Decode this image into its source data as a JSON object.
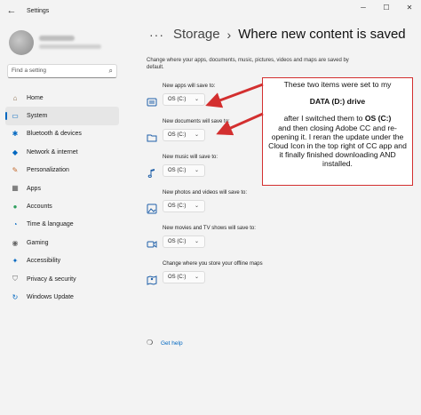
{
  "window": {
    "title": "Settings",
    "back_glyph": "←",
    "min_glyph": "─",
    "max_glyph": "☐",
    "close_glyph": "✕"
  },
  "sidebar": {
    "search_placeholder": "Find a setting",
    "search_icon_glyph": "⌕",
    "items": [
      {
        "label": "Home",
        "icon": "home-icon",
        "glyph": "⌂",
        "color": "#8a6a4a"
      },
      {
        "label": "System",
        "icon": "system-icon",
        "glyph": "▭",
        "color": "#0067c0",
        "active": true
      },
      {
        "label": "Bluetooth & devices",
        "icon": "bluetooth-icon",
        "glyph": "✱",
        "color": "#0067c0"
      },
      {
        "label": "Network & internet",
        "icon": "network-icon",
        "glyph": "◆",
        "color": "#0067c0"
      },
      {
        "label": "Personalization",
        "icon": "personalization-icon",
        "glyph": "✎",
        "color": "#c46a2d"
      },
      {
        "label": "Apps",
        "icon": "apps-icon",
        "glyph": "▦",
        "color": "#555"
      },
      {
        "label": "Accounts",
        "icon": "accounts-icon",
        "glyph": "●",
        "color": "#2e9e5e"
      },
      {
        "label": "Time & language",
        "icon": "time-language-icon",
        "glyph": "◔",
        "color": "#0067c0"
      },
      {
        "label": "Gaming",
        "icon": "gaming-icon",
        "glyph": "◉",
        "color": "#666"
      },
      {
        "label": "Accessibility",
        "icon": "accessibility-icon",
        "glyph": "✦",
        "color": "#0067c0"
      },
      {
        "label": "Privacy & security",
        "icon": "shield-icon",
        "glyph": "⛉",
        "color": "#666"
      },
      {
        "label": "Windows Update",
        "icon": "windows-update-icon",
        "glyph": "↻",
        "color": "#0067c0"
      }
    ]
  },
  "main": {
    "breadcrumb_dots": "···",
    "breadcrumb_parent": "Storage",
    "breadcrumb_sep": "›",
    "page_title": "Where new content is saved",
    "intro": "Change where your apps, documents, music, pictures, videos and maps are saved by default.",
    "chevron_glyph": "⌄",
    "groups": [
      {
        "label": "New apps will save to:",
        "value": "OS (C:)",
        "icon": "apps-storage-icon"
      },
      {
        "label": "New documents will save to:",
        "value": "OS (C:)",
        "icon": "folder-icon"
      },
      {
        "label": "New music will save to:",
        "value": "OS (C:)",
        "icon": "music-note-icon"
      },
      {
        "label": "New photos and videos will save to:",
        "value": "OS (C:)",
        "icon": "photo-icon"
      },
      {
        "label": "New movies and TV shows will save to:",
        "value": "OS (C:)",
        "icon": "video-camera-icon"
      },
      {
        "label": "Change where you store your offline maps",
        "value": "OS (C:)",
        "icon": "map-icon"
      }
    ],
    "get_help": "Get help",
    "help_icon_glyph": "❍"
  },
  "annotation": {
    "line1": "These two items were set to my",
    "line2": "DATA (D:) drive",
    "line3a": "after I switched them to ",
    "line3b": "OS (C:)",
    "line4": "and then closing Adobe CC and re-opening it. I reran the update under the Cloud Icon in the top right of CC app and it finally finished downloading AND installed.",
    "border_color": "#d32f2f"
  },
  "colors": {
    "accent": "#0067c0",
    "callout": "#d32f2f"
  }
}
